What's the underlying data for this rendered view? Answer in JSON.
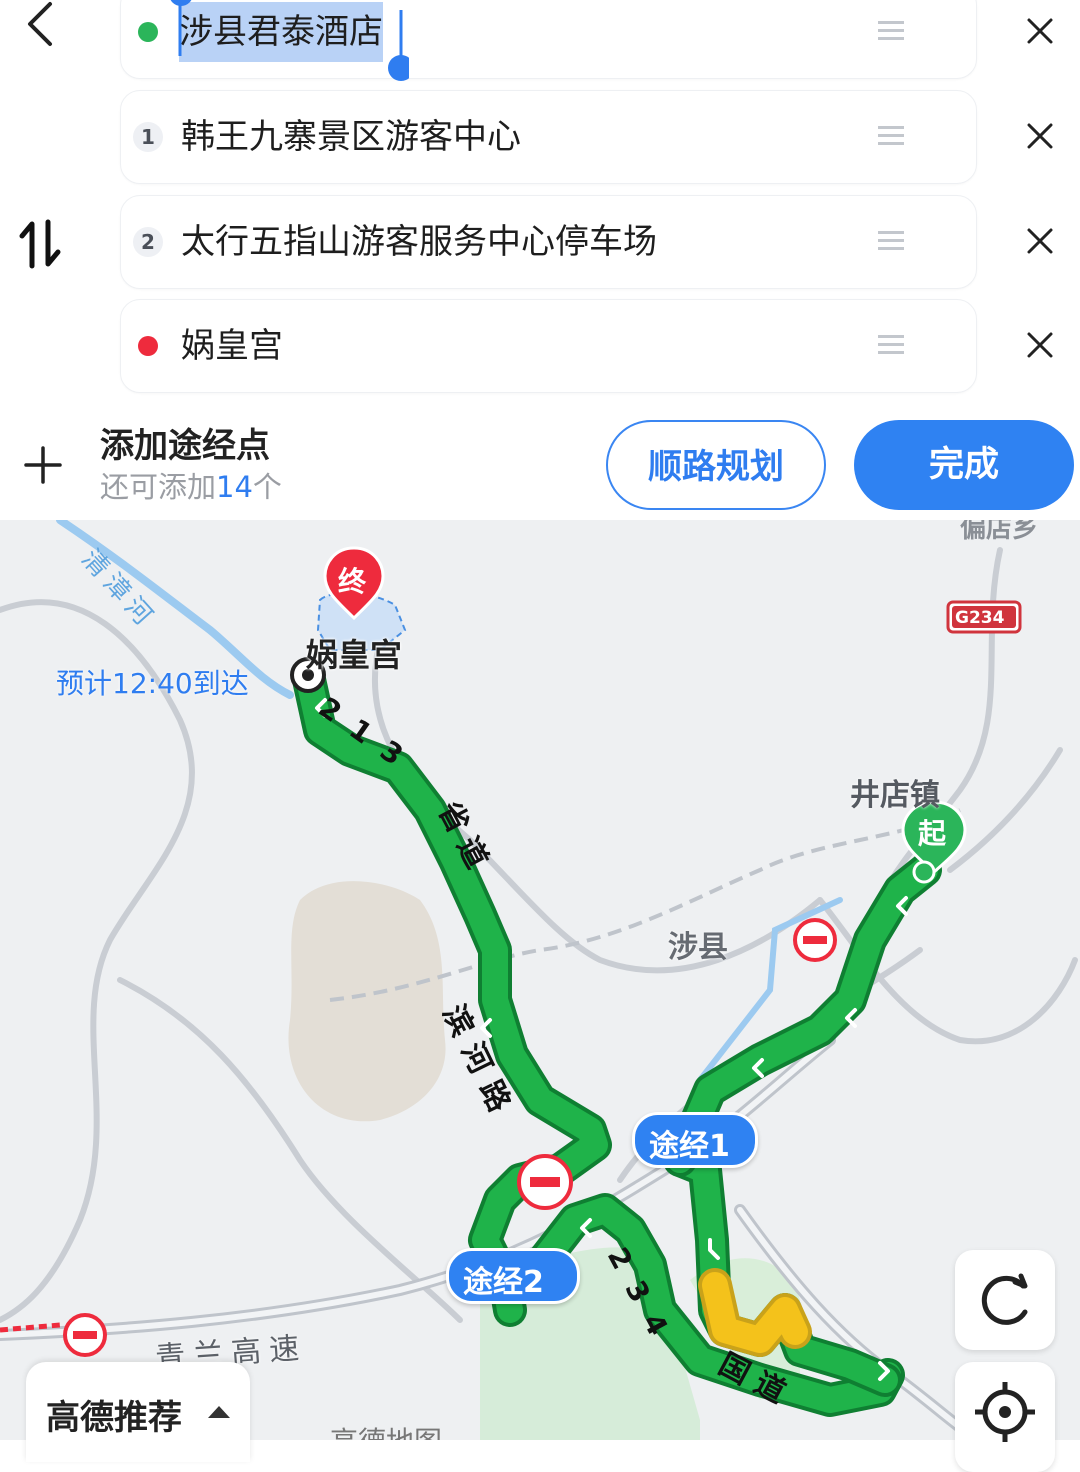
{
  "stops": {
    "start": "涉县君泰酒店",
    "via1_num": "1",
    "via1": "韩王九寨景区游客中心",
    "via2_num": "2",
    "via2": "太行五指山游客服务中心停车场",
    "end": "娲皇宫"
  },
  "add_waypoint": {
    "title": "添加途经点",
    "sub_prefix": "还可添加",
    "count": "14",
    "sub_suffix": "个"
  },
  "buttons": {
    "along_route": "顺路规划",
    "done": "完成"
  },
  "map": {
    "end_marker": "终",
    "end_place": "娲皇宫",
    "start_marker": "起",
    "eta": "预计12:40到达",
    "river": "清漳河",
    "town_jingdian": "井店镇",
    "county": "涉县",
    "road_g234": "G234",
    "town_topright": "偏店乡",
    "via1_bubble": "途经1",
    "via2_bubble": "途经2",
    "road_provincial": "省道",
    "road_num_top": "213",
    "road_binhe": "滨河路",
    "road_national": "国道",
    "road_num_bottom": "234",
    "expressway": "青兰高速",
    "watermark": "高德地图"
  },
  "bottom": {
    "recommend": "高德推荐"
  },
  "colors": {
    "accent": "#2f82f2",
    "route_green": "#1fb34a",
    "route_yellow": "#f4c21b",
    "end_red": "#ee2b3d",
    "start_green": "#2bb55a"
  }
}
